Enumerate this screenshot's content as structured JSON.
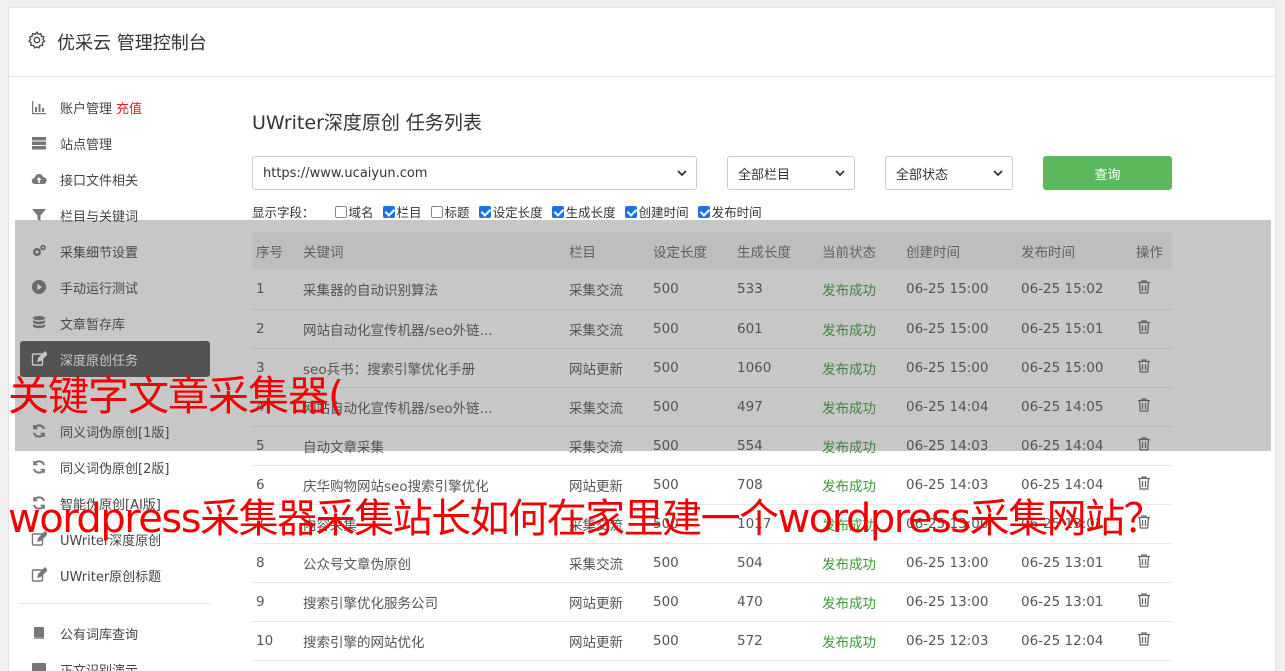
{
  "header": {
    "title": "优采云 管理控制台",
    "icon": "gear-icon"
  },
  "sidebar": {
    "items": [
      {
        "label": "账户管理",
        "badge": "充值",
        "icon": "bar-chart-icon"
      },
      {
        "label": "站点管理",
        "icon": "server-icon"
      },
      {
        "label": "接口文件相关",
        "icon": "cloud-upload-icon"
      },
      {
        "label": "栏目与关键词",
        "icon": "filter-icon"
      },
      {
        "label": "采集细节设置",
        "icon": "gears-icon"
      },
      {
        "label": "手动运行测试",
        "icon": "play-circle-icon"
      },
      {
        "label": "文章暂存库",
        "icon": "database-icon"
      },
      {
        "label": "深度原创任务",
        "icon": "edit-icon",
        "active": true
      },
      {
        "label": "",
        "icon": ""
      },
      {
        "label": "同义词伪原创[1版]",
        "icon": "refresh-icon"
      },
      {
        "label": "同义词伪原创[2版]",
        "icon": "refresh-icon"
      },
      {
        "label": "智能伪原创[AI版]",
        "icon": "refresh-icon"
      },
      {
        "label": "UWriter深度原创",
        "icon": "edit-icon"
      },
      {
        "label": "UWriter原创标题",
        "icon": "edit-icon"
      }
    ],
    "items2": [
      {
        "label": "公有词库查询",
        "icon": "book-icon"
      },
      {
        "label": "正文识别演示",
        "icon": "monitor-icon"
      }
    ]
  },
  "main": {
    "title": "UWriter深度原创 任务列表",
    "site_select": "https://www.ucaiyun.com",
    "column_select": "全部栏目",
    "status_select": "全部状态",
    "query_label": "查询",
    "fields_label": "显示字段：",
    "fields": [
      {
        "label": "域名",
        "checked": false
      },
      {
        "label": "栏目",
        "checked": true
      },
      {
        "label": "标题",
        "checked": false
      },
      {
        "label": "设定长度",
        "checked": true
      },
      {
        "label": "生成长度",
        "checked": true
      },
      {
        "label": "创建时间",
        "checked": true
      },
      {
        "label": "发布时间",
        "checked": true
      }
    ],
    "table": {
      "headers": [
        "序号",
        "关键词",
        "栏目",
        "设定长度",
        "生成长度",
        "当前状态",
        "创建时间",
        "发布时间",
        "操作"
      ],
      "rows": [
        [
          "1",
          "采集器的自动识别算法",
          "采集交流",
          "500",
          "533",
          "发布成功",
          "06-25 15:00",
          "06-25 15:02"
        ],
        [
          "2",
          "网站自动化宣传机器/seo外链...",
          "采集交流",
          "500",
          "601",
          "发布成功",
          "06-25 15:00",
          "06-25 15:01"
        ],
        [
          "3",
          "seo兵书：搜索引擎优化手册",
          "网站更新",
          "500",
          "1060",
          "发布成功",
          "06-25 15:00",
          "06-25 15:00"
        ],
        [
          "4",
          "网站自动化宣传机器/seo外链...",
          "采集交流",
          "500",
          "497",
          "发布成功",
          "06-25 14:04",
          "06-25 14:05"
        ],
        [
          "5",
          "自动文章采集",
          "采集交流",
          "500",
          "554",
          "发布成功",
          "06-25 14:03",
          "06-25 14:04"
        ],
        [
          "6",
          "庆华购物网站seo搜索引擎优化",
          "网站更新",
          "500",
          "708",
          "发布成功",
          "06-25 14:03",
          "06-25 14:04"
        ],
        [
          "7",
          "内容采集",
          "采集交流",
          "500",
          "1017",
          "发布成功",
          "06-25 13:00",
          "06-25 13:01"
        ],
        [
          "8",
          "公众号文章伪原创",
          "采集交流",
          "500",
          "504",
          "发布成功",
          "06-25 13:00",
          "06-25 13:01"
        ],
        [
          "9",
          "搜索引擎优化服务公司",
          "网站更新",
          "500",
          "470",
          "发布成功",
          "06-25 13:00",
          "06-25 13:01"
        ],
        [
          "10",
          "搜索引擎的网站优化",
          "网站更新",
          "500",
          "572",
          "发布成功",
          "06-25 12:03",
          "06-25 12:04"
        ]
      ]
    }
  },
  "overlay": {
    "caption1": "关键字文章采集器(",
    "caption2": "wordpress采集器采集站长如何在家里建一个wordpress采集网站？"
  },
  "colors": {
    "accent_green": "#5cb85c",
    "status_green": "#3a9a3a",
    "caption_red": "#f00000"
  }
}
